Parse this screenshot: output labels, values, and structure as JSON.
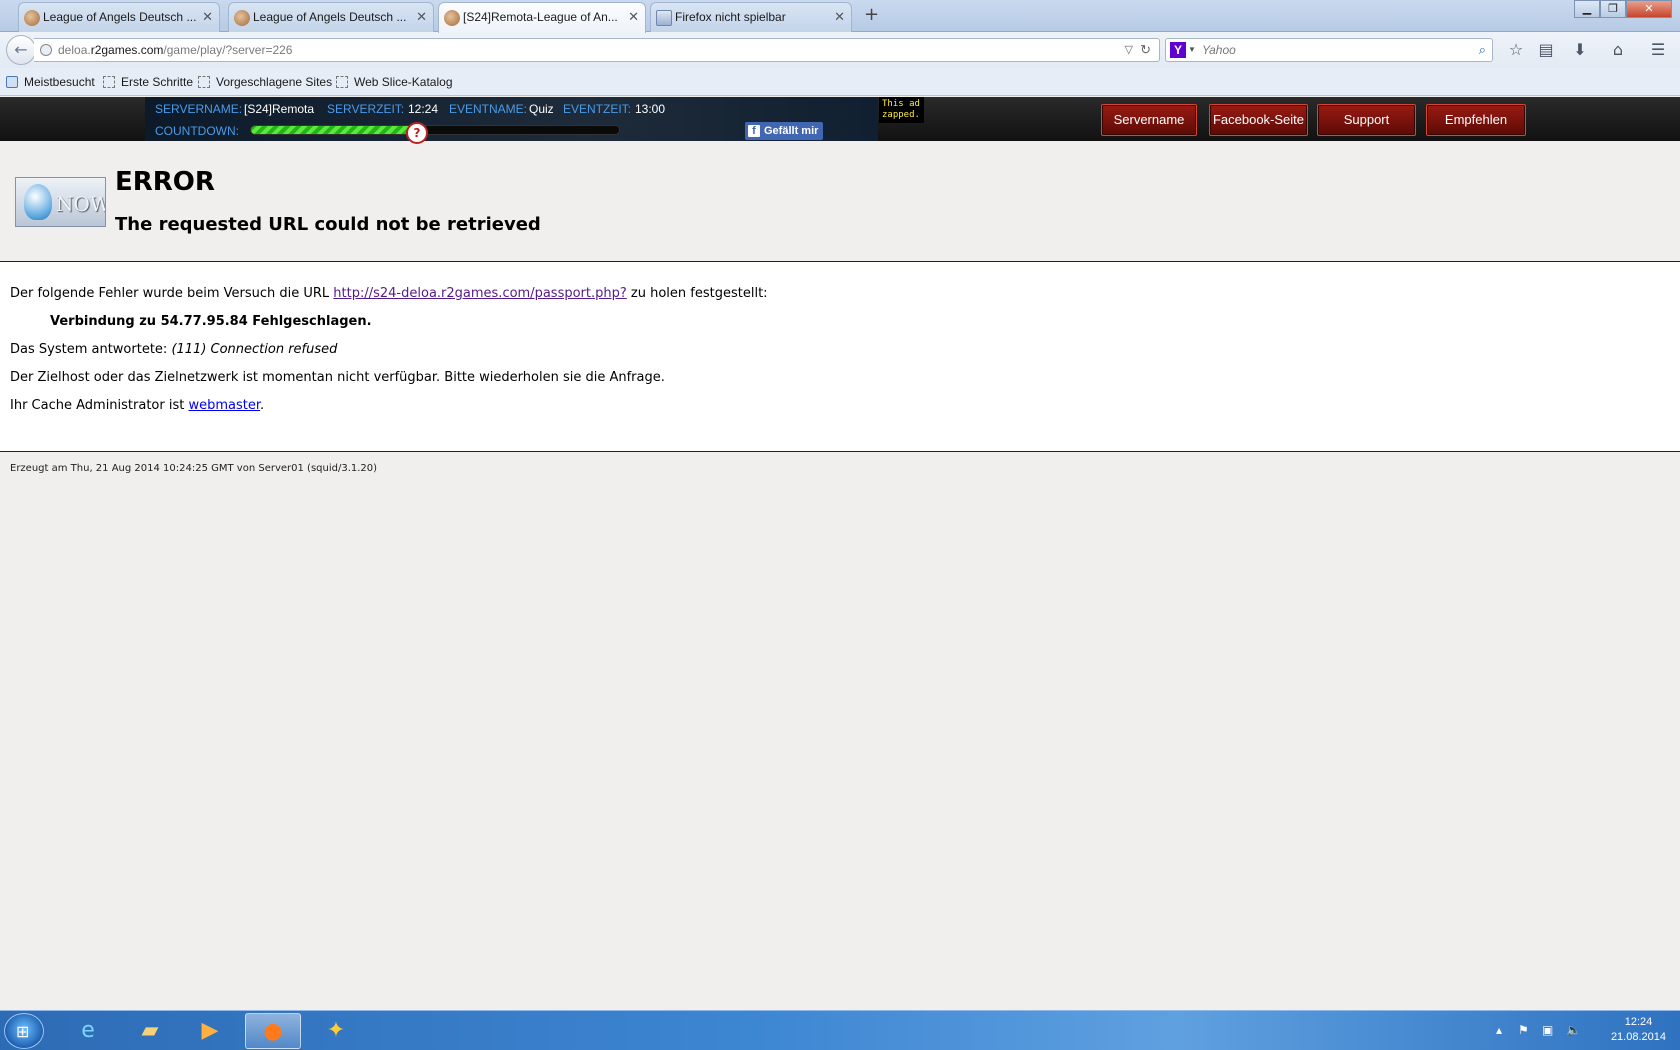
{
  "browser": {
    "tabs": [
      {
        "label": "League of Angels Deutsch ..."
      },
      {
        "label": "League of Angels Deutsch ..."
      },
      {
        "label": "[S24]Remota-League of An..."
      },
      {
        "label": "Firefox nicht spielbar"
      }
    ],
    "url": {
      "prefix": "deloa.",
      "host": "r2games.com",
      "path": "/game/play/?server=226"
    },
    "search": {
      "placeholder": "Yahoo",
      "engine_icon": "yahoo-icon"
    },
    "toolbar_icons": [
      "star-icon",
      "reading-list-icon",
      "download-icon",
      "home-icon",
      "menu-icon"
    ]
  },
  "bookmarks": [
    {
      "label": "Meistbesucht"
    },
    {
      "label": "Erste Schritte"
    },
    {
      "label": "Vorgeschlagene Sites"
    },
    {
      "label": "Web Slice-Katalog"
    }
  ],
  "gamebar": {
    "servername_label": "SERVERNAME:",
    "servername_value": "[S24]Remota",
    "serverzeit_label": "SERVERZEIT:",
    "serverzeit_value": "12:24",
    "eventname_label": "EVENTNAME:",
    "eventname_value": "Quiz",
    "eventzeit_label": "EVENTZEIT:",
    "eventzeit_value": "13:00",
    "countdown_label": "COUNTDOWN:",
    "countdown_progress": 0.44,
    "facebook_like": "Gefällt mir",
    "ad_zapped": "This ad zapped.",
    "buttons": [
      "Servername",
      "Facebook-Seite",
      "Support",
      "Empfehlen"
    ]
  },
  "error": {
    "title": "ERROR",
    "subtitle": "The requested URL could not be retrieved",
    "line1_pre": "Der folgende Fehler wurde beim Versuch die URL ",
    "line1_link": "http://s24-deloa.r2games.com/passport.php?",
    "line1_post": " zu holen festgestellt:",
    "line2": "Verbindung zu 54.77.95.84 Fehlgeschlagen.",
    "line3_pre": "Das System antwortete: ",
    "line3_em": "(111) Connection refused",
    "line4": "Der Zielhost oder das Zielnetzwerk ist momentan nicht verfügbar. Bitte wiederholen sie die Anfrage.",
    "line5_pre": "Ihr Cache Administrator ist ",
    "line5_link": "webmaster",
    "line5_post": ".",
    "footer": "Erzeugt am Thu, 21 Aug 2014 10:24:25 GMT von Server01 (squid/3.1.20)"
  },
  "taskbar": {
    "apps": [
      "internet-explorer-icon",
      "file-explorer-icon",
      "media-player-icon",
      "firefox-icon",
      "game-icon"
    ],
    "time": "12:24",
    "date": "21.08.2014"
  }
}
